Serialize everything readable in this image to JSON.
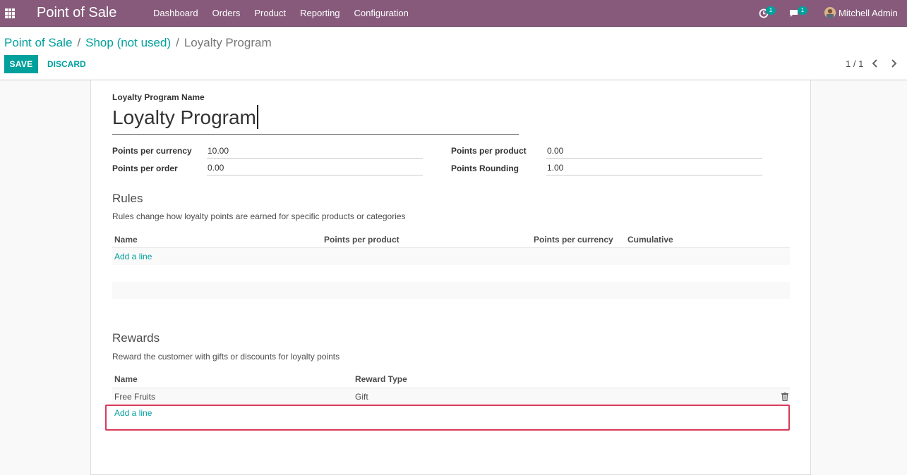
{
  "navbar": {
    "app_title": "Point of Sale",
    "menu": [
      "Dashboard",
      "Orders",
      "Product",
      "Reporting",
      "Configuration"
    ],
    "activity_count": "1",
    "messages_count": "1",
    "user_name": "Mitchell Admin"
  },
  "breadcrumb": {
    "items": [
      "Point of Sale",
      "Shop (not used)"
    ],
    "separator": "/",
    "current": "Loyalty Program"
  },
  "toolbar": {
    "save_label": "SAVE",
    "discard_label": "DISCARD",
    "pager": "1 / 1"
  },
  "form": {
    "name_label": "Loyalty Program Name",
    "name_value": "Loyalty Program",
    "fields": {
      "points_per_currency": {
        "label": "Points per currency",
        "value": "10.00"
      },
      "points_per_order": {
        "label": "Points per order",
        "value": "0.00"
      },
      "points_per_product": {
        "label": "Points per product",
        "value": "0.00"
      },
      "points_rounding": {
        "label": "Points Rounding",
        "value": "1.00"
      }
    },
    "rules": {
      "title": "Rules",
      "help": "Rules change how loyalty points are earned for specific products or categories",
      "columns": [
        "Name",
        "Points per product",
        "Points per currency",
        "Cumulative"
      ],
      "add_line": "Add a line"
    },
    "rewards": {
      "title": "Rewards",
      "help": "Reward the customer with gifts or discounts for loyalty points",
      "columns": [
        "Name",
        "Reward Type"
      ],
      "rows": [
        {
          "name": "Free Fruits",
          "reward_type": "Gift"
        }
      ],
      "add_line": "Add a line"
    }
  },
  "colors": {
    "navbar": "#875a7b",
    "accent": "#00a09d",
    "highlight": "#d93a5a"
  }
}
